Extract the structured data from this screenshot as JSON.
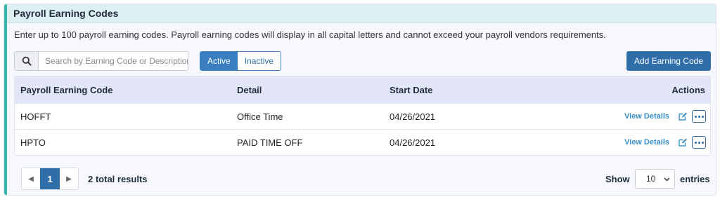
{
  "panel": {
    "title": "Payroll Earning Codes",
    "intro": "Enter up to 100 payroll earning codes. Payroll earning codes will display in all capital letters and cannot exceed your payroll vendors requirements."
  },
  "toolbar": {
    "search_placeholder": "Search by Earning Code or Description",
    "search_value": "",
    "filter_active": "Active",
    "filter_inactive": "Inactive",
    "selected_filter": "Active",
    "add_button": "Add Earning Code"
  },
  "table": {
    "columns": [
      "Payroll Earning Code",
      "Detail",
      "Start Date",
      "Actions"
    ],
    "rows": [
      {
        "code": "HOFFT",
        "detail": "Office Time",
        "start_date": "04/26/2021",
        "action_link": "View Details"
      },
      {
        "code": "HPTO",
        "detail": "PAID TIME OFF",
        "start_date": "04/26/2021",
        "action_link": "View Details"
      }
    ]
  },
  "footer": {
    "current_page": "1",
    "results_text": "2 total results",
    "show_label": "Show",
    "entries_value": "10",
    "entries_label": "entries"
  },
  "icons": {
    "search": "search-icon",
    "edit": "edit-icon",
    "more": "more-options-icon",
    "prev": "chevron-left-icon",
    "next": "chevron-right-icon",
    "dropdown": "chevron-down-icon"
  },
  "colors": {
    "accent_border": "#35b5ae",
    "header_bg": "#ddeff2",
    "primary_button": "#2f6ea8",
    "table_header_bg": "#e3e6fa",
    "link": "#3a8fc8"
  }
}
